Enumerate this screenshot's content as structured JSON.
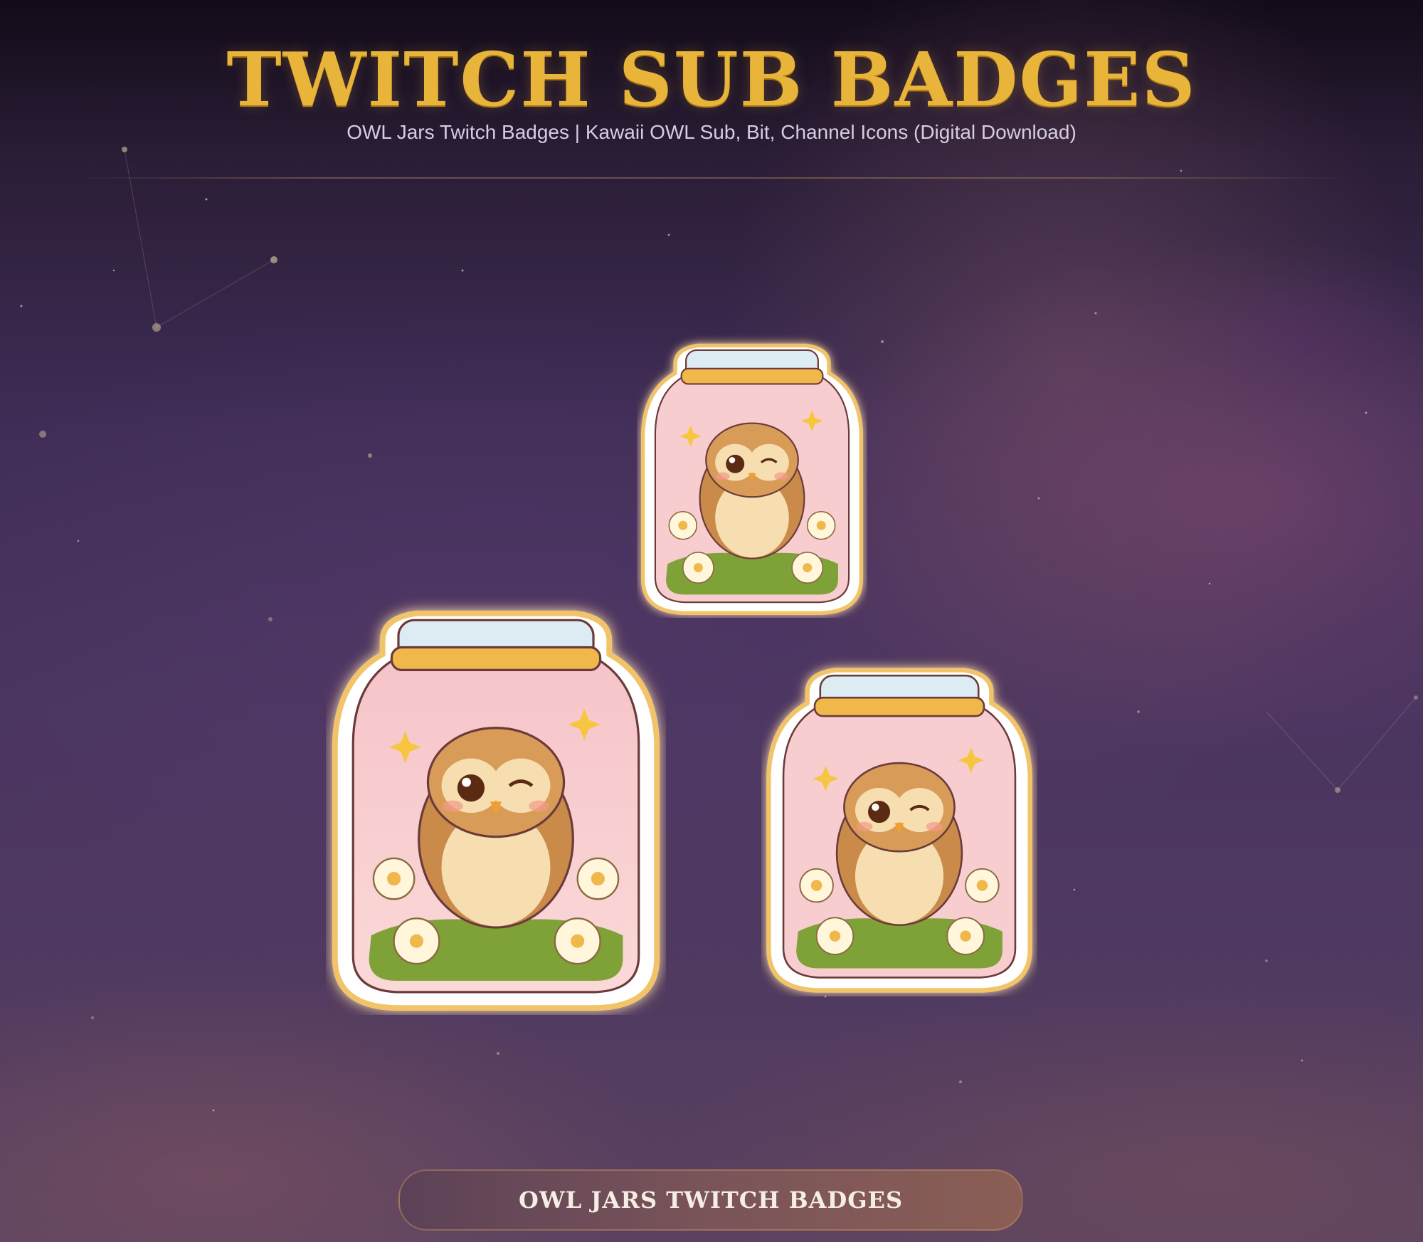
{
  "header": {
    "title": "TWITCH SUB BADGES",
    "subtitle": "OWL Jars Twitch Badges | Kawaii OWL Sub, Bit, Channel Icons (Digital Download)"
  },
  "badges": [
    {
      "name": "owl-jar-badge-large",
      "icon": "owl-jar-icon"
    },
    {
      "name": "owl-jar-badge-small",
      "icon": "owl-jar-icon"
    },
    {
      "name": "owl-jar-badge-medium",
      "icon": "owl-jar-icon"
    }
  ],
  "footer": {
    "label": "OWL JARS TWITCH BADGES"
  },
  "colors": {
    "title_gold": "#e8b43a",
    "subtitle": "#d6cde0",
    "jar_pink": "#f7c7cc",
    "lid_gold": "#f0b84a",
    "owl_brown": "#c98a4a",
    "grass_green": "#7fa238",
    "background_purple": "#3f2d57"
  }
}
